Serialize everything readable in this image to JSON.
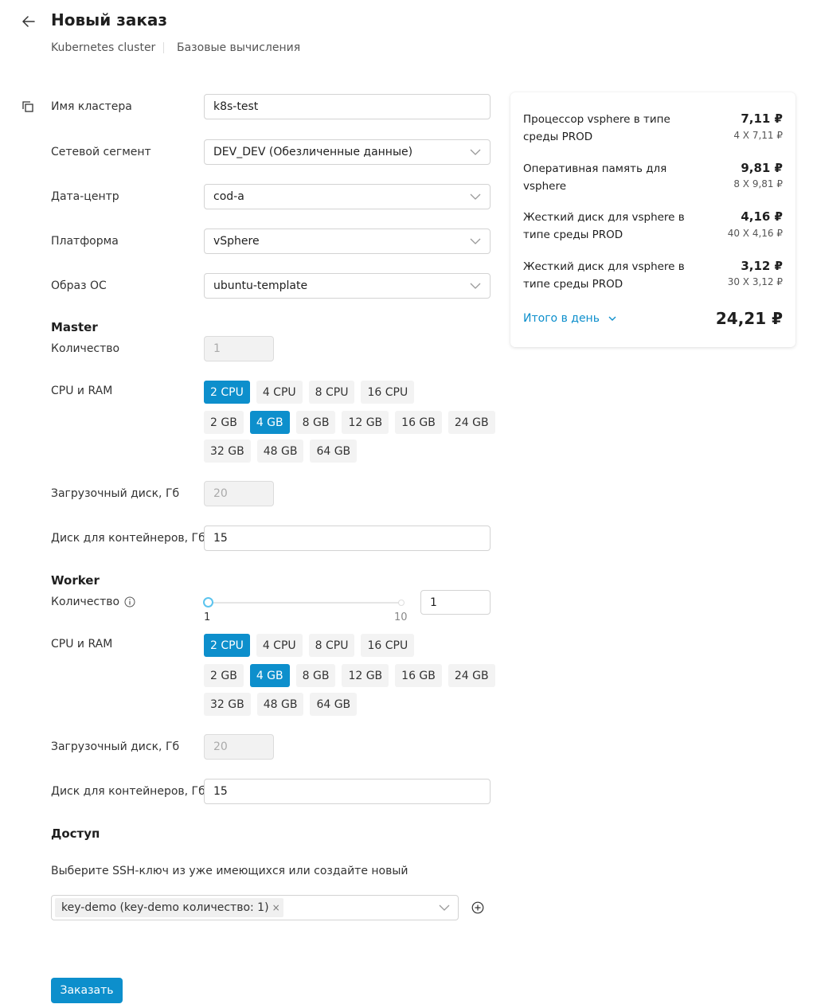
{
  "header": {
    "title": "Новый заказ",
    "breadcrumbs": [
      "Kubernetes cluster",
      "Базовые вычисления"
    ]
  },
  "form": {
    "cluster_name": {
      "label": "Имя кластера",
      "value": "k8s-test"
    },
    "network_segment": {
      "label": "Сетевой сегмент",
      "value": "DEV_DEV (Обезличенные данные)"
    },
    "datacenter": {
      "label": "Дата-центр",
      "value": "cod-a"
    },
    "platform": {
      "label": "Платформа",
      "value": "vSphere"
    },
    "os_image": {
      "label": "Образ ОС",
      "value": "ubuntu-template"
    }
  },
  "master": {
    "title": "Master",
    "count_label": "Количество",
    "count_value": "1",
    "cpu_ram_label": "CPU и RAM",
    "cpu_options": [
      "2 CPU",
      "4 CPU",
      "8 CPU",
      "16 CPU"
    ],
    "cpu_selected": "2 CPU",
    "ram_options": [
      "2 GB",
      "4 GB",
      "8 GB",
      "12 GB",
      "16 GB",
      "24 GB",
      "32 GB",
      "48 GB",
      "64 GB"
    ],
    "ram_selected": "4 GB",
    "boot_disk_label": "Загрузочный диск, Гб",
    "boot_disk_value": "20",
    "container_disk_label": "Диск для контейнеров, Гб",
    "container_disk_value": "15"
  },
  "worker": {
    "title": "Worker",
    "count_label": "Количество",
    "count_value": "1",
    "slider": {
      "min": "1",
      "max": "10",
      "value": 1
    },
    "cpu_ram_label": "CPU и RAM",
    "cpu_options": [
      "2 CPU",
      "4 CPU",
      "8 CPU",
      "16 CPU"
    ],
    "cpu_selected": "2 CPU",
    "ram_options": [
      "2 GB",
      "4 GB",
      "8 GB",
      "12 GB",
      "16 GB",
      "24 GB",
      "32 GB",
      "48 GB",
      "64 GB"
    ],
    "ram_selected": "4 GB",
    "boot_disk_label": "Загрузочный диск, Гб",
    "boot_disk_value": "20",
    "container_disk_label": "Диск для контейнеров, Гб",
    "container_disk_value": "15"
  },
  "access": {
    "title": "Доступ",
    "hint": "Выберите SSH-ключ из уже имеющихся или создайте новый",
    "selected_key": "key-demo (key-demo количество: 1)",
    "remove_glyph": "×"
  },
  "actions": {
    "order_label": "Заказать"
  },
  "summary": {
    "items": [
      {
        "name": "Процессор vsphere в типе среды PROD",
        "price": "7,11 ₽",
        "detail": "4 X 7,11 ₽"
      },
      {
        "name": "Оперативная память для vsphere",
        "price": "9,81 ₽",
        "detail": "8 X 9,81 ₽"
      },
      {
        "name": "Жесткий диск для vsphere в типе среды PROD",
        "price": "4,16 ₽",
        "detail": "40 X 4,16 ₽"
      },
      {
        "name": "Жесткий диск для vsphere в типе среды PROD",
        "price": "3,12 ₽",
        "detail": "30 X 3,12 ₽"
      }
    ],
    "total_label": "Итого в день",
    "total_value": "24,21 ₽"
  },
  "colors": {
    "accent": "#0d8fcc",
    "chip_bg": "#f3f3f3",
    "disabled_bg": "#f2f2f2"
  },
  "icons": {
    "back": "arrow-left-icon",
    "copy": "copy-icon",
    "chevron": "chevron-down-icon",
    "info": "info-icon",
    "add": "plus-circle-icon"
  }
}
